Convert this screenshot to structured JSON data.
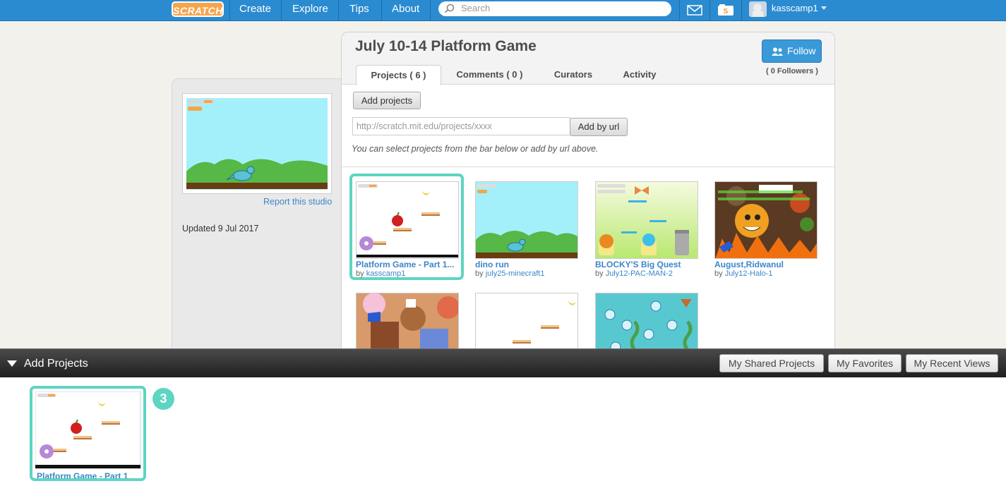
{
  "nav": {
    "logo": "SCRATCH",
    "links": [
      "Create",
      "Explore",
      "Tips",
      "About"
    ],
    "search_placeholder": "Search",
    "username": "kasscamp1"
  },
  "sidebar": {
    "report_link": "Report this studio",
    "updated": "Updated 9 Jul 2017"
  },
  "studio": {
    "title": "July 10-14 Platform Game",
    "follow_label": "Follow",
    "followers": "( 0 Followers )",
    "tabs": [
      "Projects ( 6 )",
      "Comments ( 0 )",
      "Curators",
      "Activity"
    ],
    "add_projects_button": "Add projects",
    "url_placeholder": "http://scratch.mit.edu/projects/xxxx",
    "add_by_url_button": "Add by url",
    "hint": "You can select projects from the bar below or add by url above."
  },
  "projects": [
    {
      "title": "Platform Game - Part 1...",
      "by": "by ",
      "author": "kasscamp1"
    },
    {
      "title": "dino run",
      "by": "by ",
      "author": "july25-minecraft1"
    },
    {
      "title": "BLOCKY'S Big Quest",
      "by": "by ",
      "author": "July12-PAC-MAN-2"
    },
    {
      "title": "August,Ridwanul",
      "by": "by ",
      "author": "July12-Halo-1"
    }
  ],
  "addbar": {
    "title": "Add Projects",
    "buttons": [
      "My Shared Projects",
      "My Favorites",
      "My Recent Views"
    ]
  },
  "bottom": {
    "project_title": "Platform Game - Part 1",
    "badge": "3"
  },
  "colors": {
    "nav_blue": "#2a8bd0",
    "link_blue": "#3d86c7",
    "highlight_teal": "#5ed5c2",
    "follow_blue": "#3a9ad9"
  }
}
